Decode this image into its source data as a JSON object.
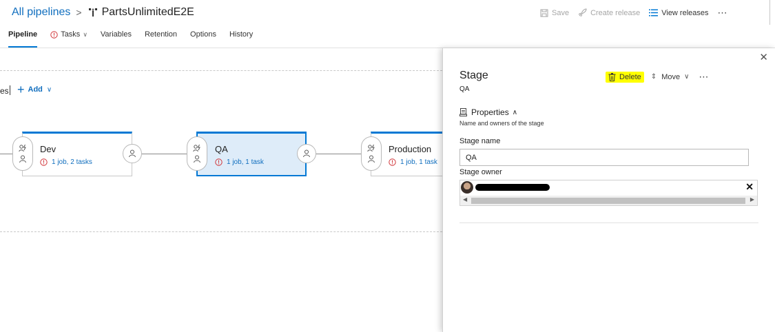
{
  "header": {
    "breadcrumb_all": "All pipelines",
    "breadcrumb_sep": ">",
    "pipeline_name": "PartsUnlimitedE2E",
    "actions": {
      "save": "Save",
      "create_release": "Create release",
      "view_releases": "View releases",
      "more": "⋯"
    }
  },
  "tabs": [
    {
      "label": "Pipeline",
      "active": true
    },
    {
      "label": "Tasks",
      "warning": true,
      "dropdown": true
    },
    {
      "label": "Variables"
    },
    {
      "label": "Retention"
    },
    {
      "label": "Options"
    },
    {
      "label": "History"
    }
  ],
  "canvas": {
    "stages_label": "es",
    "add_label": "Add",
    "stages": [
      {
        "name": "Dev",
        "status": "1 job, 2 tasks",
        "selected": false
      },
      {
        "name": "QA",
        "status": "1 job, 1 task",
        "selected": true
      },
      {
        "name": "Production",
        "status": "1 job, 1 task",
        "selected": false
      }
    ]
  },
  "panel": {
    "title": "Stage",
    "subtitle": "QA",
    "delete_label": "Delete",
    "move_label": "Move",
    "more": "⋯",
    "close": "✕",
    "properties_title": "Properties",
    "properties_desc": "Name and owners of the stage",
    "stage_name_label": "Stage name",
    "stage_name_value": "QA",
    "stage_owner_label": "Stage owner",
    "owner_remove": "✕"
  },
  "colors": {
    "accent": "#0078d4",
    "link": "#106ebe",
    "warning": "#d13438",
    "highlight": "#ffff00",
    "selected_bg": "#deecf9"
  }
}
